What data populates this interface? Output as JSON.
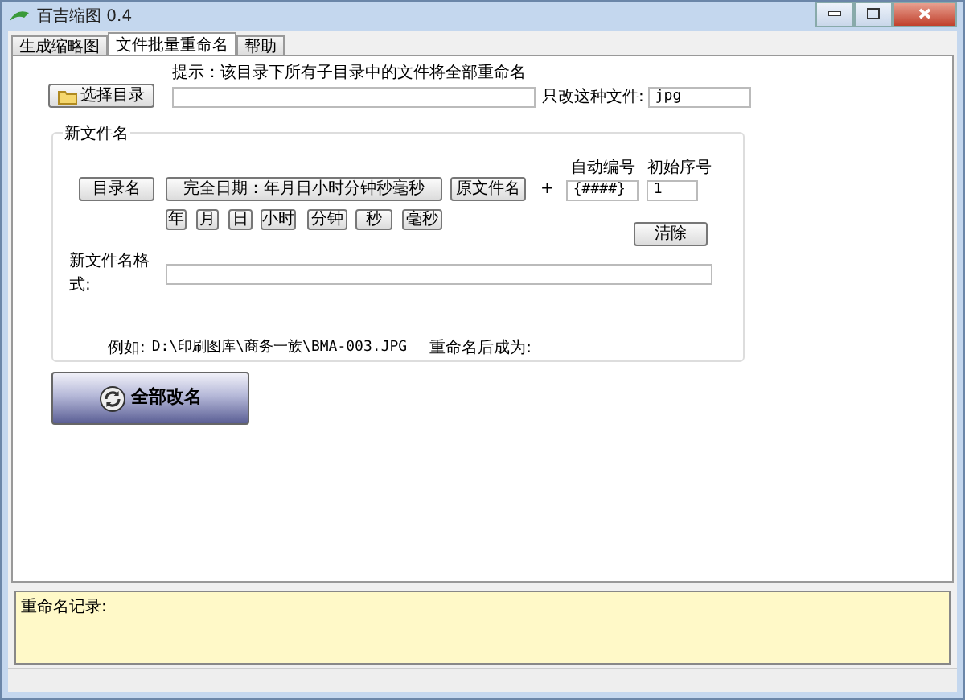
{
  "window": {
    "title": "百吉缩图 0.4"
  },
  "tabs": [
    {
      "label": "生成缩略图",
      "selected": false
    },
    {
      "label": "文件批量重命名",
      "selected": true
    },
    {
      "label": "帮助",
      "selected": false
    }
  ],
  "select_dir_button": "选择目录",
  "hint": "提示：该目录下所有子目录中的文件将全部重命名",
  "extension_label": "只改这种文件:",
  "extension_value": "jpg",
  "group": {
    "legend": "新文件名",
    "dir_name_button": "目录名",
    "full_date_button": "完全日期：年月日小时分钟秒毫秒",
    "original_name_button": "原文件名",
    "plus": "+",
    "auto_number_label": "自动编号",
    "auto_number_value": "{####}",
    "start_number_label": "初始序号",
    "start_number_value": "1",
    "date_part_buttons": [
      "年",
      "月",
      "日",
      "小时",
      "分钟",
      "秒",
      "毫秒"
    ],
    "clear_button": "清除",
    "format_label": "新文件名格式:",
    "example_label": "例如:",
    "example_path": "D:\\印刷图库\\商务一族\\BMA-003.JPG",
    "result_label": "重命名后成为:"
  },
  "rename_all_button": "全部改名",
  "log_label": "重命名记录:"
}
